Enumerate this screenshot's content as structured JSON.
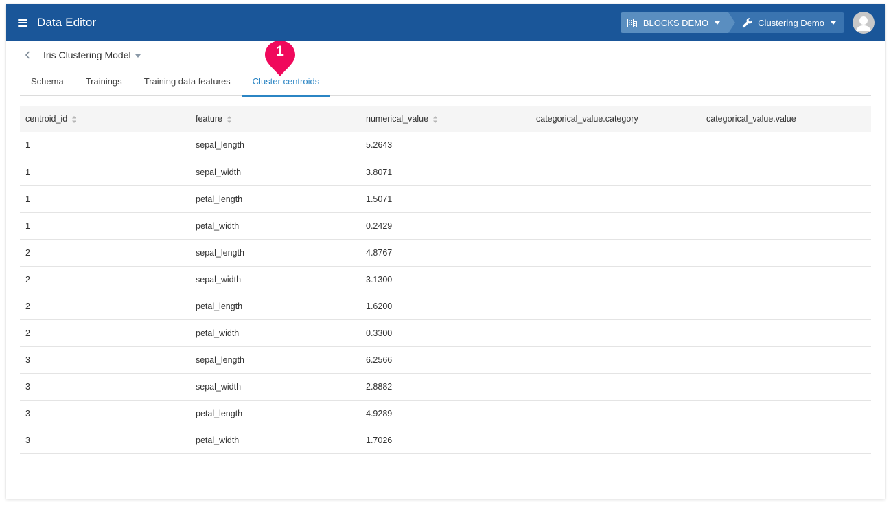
{
  "header": {
    "app_title": "Data Editor",
    "menu_icon": "hamburger-menu-icon",
    "org": {
      "label": "BLOCKS DEMO",
      "icon": "building-icon"
    },
    "project": {
      "label": "Clustering Demo",
      "icon": "wrench-icon"
    },
    "avatar_icon": "user-avatar-icon",
    "colors": {
      "bar": "#1a5699",
      "org_bg": "#5a8ec0",
      "project_bg": "#3a74b0"
    }
  },
  "model": {
    "back_icon": "chevron-left-icon",
    "title": "Iris Clustering Model"
  },
  "tabs": [
    {
      "label": "Schema",
      "active": false
    },
    {
      "label": "Trainings",
      "active": false
    },
    {
      "label": "Training data features",
      "active": false
    },
    {
      "label": "Cluster centroids",
      "active": true
    }
  ],
  "annotation_badge": {
    "number": "1",
    "color": "#f0095c"
  },
  "table": {
    "columns": [
      {
        "label": "centroid_id",
        "sortable": true
      },
      {
        "label": "feature",
        "sortable": true
      },
      {
        "label": "numerical_value",
        "sortable": true
      },
      {
        "label": "categorical_value.category",
        "sortable": false
      },
      {
        "label": "categorical_value.value",
        "sortable": false
      }
    ],
    "rows": [
      [
        "1",
        "sepal_length",
        "5.2643",
        "",
        ""
      ],
      [
        "1",
        "sepal_width",
        "3.8071",
        "",
        ""
      ],
      [
        "1",
        "petal_length",
        "1.5071",
        "",
        ""
      ],
      [
        "1",
        "petal_width",
        "0.2429",
        "",
        ""
      ],
      [
        "2",
        "sepal_length",
        "4.8767",
        "",
        ""
      ],
      [
        "2",
        "sepal_width",
        "3.1300",
        "",
        ""
      ],
      [
        "2",
        "petal_length",
        "1.6200",
        "",
        ""
      ],
      [
        "2",
        "petal_width",
        "0.3300",
        "",
        ""
      ],
      [
        "3",
        "sepal_length",
        "6.2566",
        "",
        ""
      ],
      [
        "3",
        "sepal_width",
        "2.8882",
        "",
        ""
      ],
      [
        "3",
        "petal_length",
        "4.9289",
        "",
        ""
      ],
      [
        "3",
        "petal_width",
        "1.7026",
        "",
        ""
      ]
    ]
  },
  "accent_color": "#2b85c4"
}
